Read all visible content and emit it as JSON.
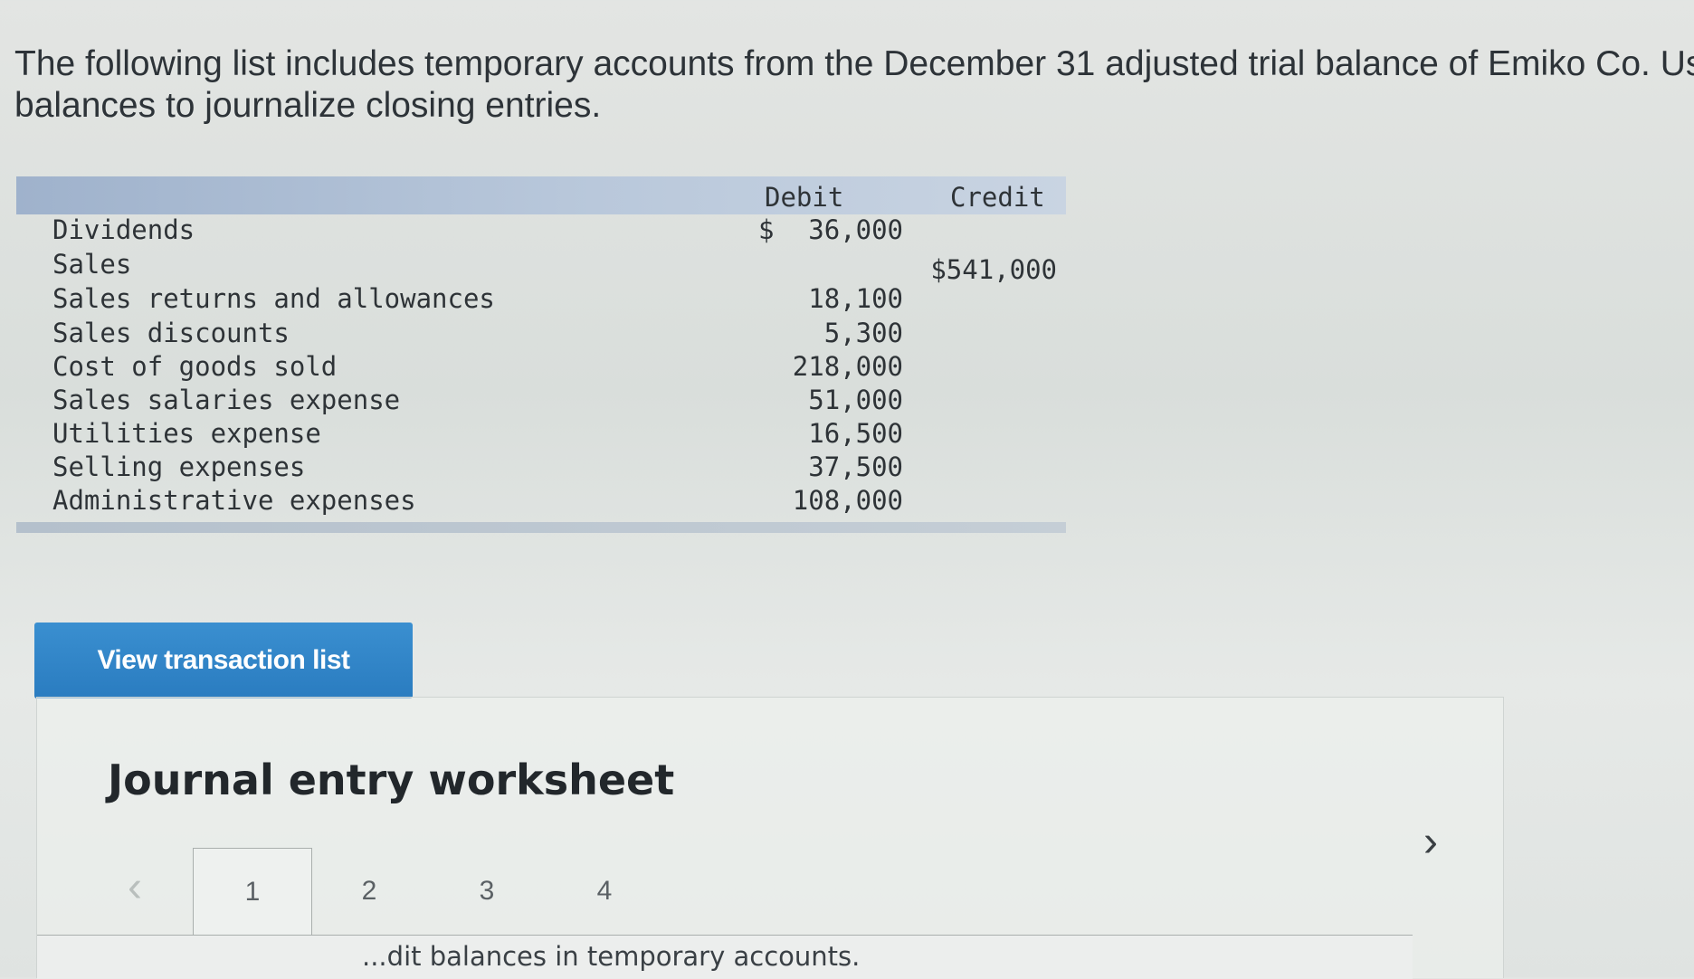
{
  "intro": {
    "line1": "The following list includes temporary accounts from the December 31 adjusted trial balance of Emiko Co. Use",
    "line2": "balances to journalize closing entries."
  },
  "table": {
    "debit_header": "Debit",
    "credit_header": "Credit",
    "rows": [
      {
        "account": "Dividends",
        "dollar": "$",
        "debit": "36,000",
        "credit": ""
      },
      {
        "account": "Sales",
        "dollar": "",
        "debit": "",
        "credit": "$541,000"
      },
      {
        "account": "Sales returns and allowances",
        "dollar": "",
        "debit": "18,100",
        "credit": ""
      },
      {
        "account": "Sales discounts",
        "dollar": "",
        "debit": "5,300",
        "credit": ""
      },
      {
        "account": "Cost of goods sold",
        "dollar": "",
        "debit": "218,000",
        "credit": ""
      },
      {
        "account": "Sales salaries expense",
        "dollar": "",
        "debit": "51,000",
        "credit": ""
      },
      {
        "account": "Utilities expense",
        "dollar": "",
        "debit": "16,500",
        "credit": ""
      },
      {
        "account": "Selling expenses",
        "dollar": "",
        "debit": "37,500",
        "credit": ""
      },
      {
        "account": "Administrative expenses",
        "dollar": "",
        "debit": "108,000",
        "credit": ""
      }
    ]
  },
  "view_button_label": "View transaction list",
  "worksheet": {
    "title": "Journal entry worksheet",
    "prev_glyph": "‹",
    "next_glyph": "›",
    "tabs": [
      "1",
      "2",
      "3",
      "4"
    ],
    "active_tab": "1",
    "instruction_fragment": "...dit balances in temporary accounts."
  },
  "icons": {
    "prev": "chevron-left-icon",
    "next": "chevron-right-icon"
  },
  "colors": {
    "button": "#2a7cc0",
    "header_bar": "#b9c8db"
  }
}
